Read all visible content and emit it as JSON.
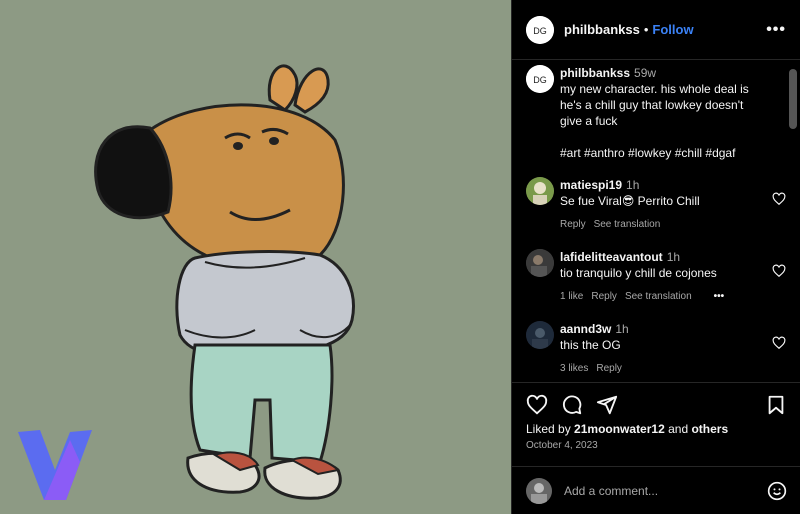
{
  "post": {
    "username": "philbbankss",
    "follow_label": "Follow",
    "separator": "•",
    "more_label": "•••"
  },
  "caption": {
    "username": "philbbankss",
    "time": "59w",
    "text": "my new character. his whole deal is he's a chill guy that lowkey doesn't give a fuck",
    "hashtags": "#art #anthro #lowkey #chill #dgaf"
  },
  "comments": [
    {
      "username": "matiespi19",
      "time": "1h",
      "text": "Se fue Viral😎 Perrito Chill",
      "likes": "",
      "reply": "Reply",
      "translate": "See translation"
    },
    {
      "username": "lafidelitteavantout",
      "time": "1h",
      "text": "tio tranquilo y chill de cojones",
      "likes": "1 like",
      "reply": "Reply",
      "translate": "See translation",
      "more": "•••"
    },
    {
      "username": "aannd3w",
      "time": "1h",
      "text": "this the OG",
      "likes": "3 likes",
      "reply": "Reply",
      "translate": ""
    }
  ],
  "likes": {
    "prefix": "Liked by",
    "user": "21moonwater12",
    "joiner": "and",
    "others": "others"
  },
  "date": "October 4, 2023",
  "add_comment": {
    "placeholder": "Add a comment..."
  },
  "icons": [
    "heart-icon",
    "comment-icon",
    "share-icon",
    "bookmark-icon",
    "emoji-icon",
    "more-icon"
  ],
  "colors": {
    "image_bg": "#8d9a84",
    "follow": "#3b82f6",
    "panel_bg": "#000000"
  }
}
